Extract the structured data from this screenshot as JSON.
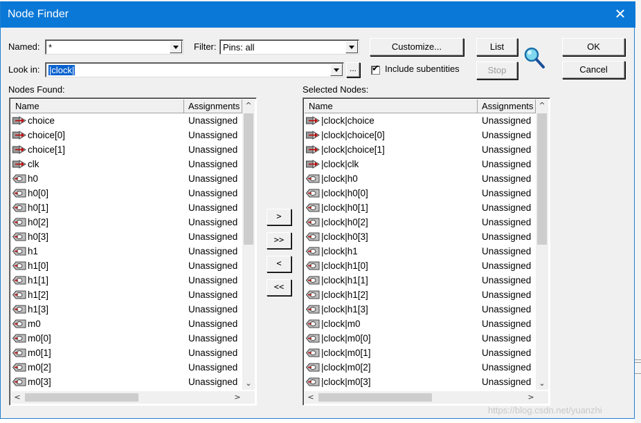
{
  "dialog": {
    "title": "Node Finder",
    "close_glyph": "✕"
  },
  "named": {
    "label": "Named:",
    "value": "*"
  },
  "filter": {
    "label": "Filter:",
    "value": "Pins: all"
  },
  "look_in": {
    "label": "Look in:",
    "value": "|clock|"
  },
  "browse_label": "...",
  "include_subentities": {
    "label": "Include subentities",
    "checked": true,
    "mark": "✔"
  },
  "buttons": {
    "customize": "Customize...",
    "list": "List",
    "stop": "Stop",
    "ok": "OK",
    "cancel": "Cancel",
    "move_one_right": ">",
    "move_all_right": ">>",
    "move_one_left": "<",
    "move_all_left": "<<"
  },
  "nodes_found": {
    "label": "Nodes Found:",
    "columns": [
      "Name",
      "Assignments"
    ],
    "rows": [
      {
        "name": "choice",
        "assign": "Unassigned",
        "icon": "input-pin-icon"
      },
      {
        "name": "choice[0]",
        "assign": "Unassigned",
        "icon": "input-pin-icon"
      },
      {
        "name": "choice[1]",
        "assign": "Unassigned",
        "icon": "input-pin-icon"
      },
      {
        "name": "clk",
        "assign": "Unassigned",
        "icon": "input-pin-icon"
      },
      {
        "name": "h0",
        "assign": "Unassigned",
        "icon": "output-pin-icon"
      },
      {
        "name": "h0[0]",
        "assign": "Unassigned",
        "icon": "output-pin-icon"
      },
      {
        "name": "h0[1]",
        "assign": "Unassigned",
        "icon": "output-pin-icon"
      },
      {
        "name": "h0[2]",
        "assign": "Unassigned",
        "icon": "output-pin-icon"
      },
      {
        "name": "h0[3]",
        "assign": "Unassigned",
        "icon": "output-pin-icon"
      },
      {
        "name": "h1",
        "assign": "Unassigned",
        "icon": "output-pin-icon"
      },
      {
        "name": "h1[0]",
        "assign": "Unassigned",
        "icon": "output-pin-icon"
      },
      {
        "name": "h1[1]",
        "assign": "Unassigned",
        "icon": "output-pin-icon"
      },
      {
        "name": "h1[2]",
        "assign": "Unassigned",
        "icon": "output-pin-icon"
      },
      {
        "name": "h1[3]",
        "assign": "Unassigned",
        "icon": "output-pin-icon"
      },
      {
        "name": "m0",
        "assign": "Unassigned",
        "icon": "output-pin-icon"
      },
      {
        "name": "m0[0]",
        "assign": "Unassigned",
        "icon": "output-pin-icon"
      },
      {
        "name": "m0[1]",
        "assign": "Unassigned",
        "icon": "output-pin-icon"
      },
      {
        "name": "m0[2]",
        "assign": "Unassigned",
        "icon": "output-pin-icon"
      },
      {
        "name": "m0[3]",
        "assign": "Unassigned",
        "icon": "output-pin-icon"
      }
    ]
  },
  "selected_nodes": {
    "label": "Selected Nodes:",
    "columns": [
      "Name",
      "Assignments"
    ],
    "rows": [
      {
        "name": "|clock|choice",
        "assign": "Unassigned",
        "icon": "input-pin-icon"
      },
      {
        "name": "|clock|choice[0]",
        "assign": "Unassigned",
        "icon": "input-pin-icon"
      },
      {
        "name": "|clock|choice[1]",
        "assign": "Unassigned",
        "icon": "input-pin-icon"
      },
      {
        "name": "|clock|clk",
        "assign": "Unassigned",
        "icon": "input-pin-icon"
      },
      {
        "name": "|clock|h0",
        "assign": "Unassigned",
        "icon": "output-pin-icon"
      },
      {
        "name": "|clock|h0[0]",
        "assign": "Unassigned",
        "icon": "output-pin-icon"
      },
      {
        "name": "|clock|h0[1]",
        "assign": "Unassigned",
        "icon": "output-pin-icon"
      },
      {
        "name": "|clock|h0[2]",
        "assign": "Unassigned",
        "icon": "output-pin-icon"
      },
      {
        "name": "|clock|h0[3]",
        "assign": "Unassigned",
        "icon": "output-pin-icon"
      },
      {
        "name": "|clock|h1",
        "assign": "Unassigned",
        "icon": "output-pin-icon"
      },
      {
        "name": "|clock|h1[0]",
        "assign": "Unassigned",
        "icon": "output-pin-icon"
      },
      {
        "name": "|clock|h1[1]",
        "assign": "Unassigned",
        "icon": "output-pin-icon"
      },
      {
        "name": "|clock|h1[2]",
        "assign": "Unassigned",
        "icon": "output-pin-icon"
      },
      {
        "name": "|clock|h1[3]",
        "assign": "Unassigned",
        "icon": "output-pin-icon"
      },
      {
        "name": "|clock|m0",
        "assign": "Unassigned",
        "icon": "output-pin-icon"
      },
      {
        "name": "|clock|m0[0]",
        "assign": "Unassigned",
        "icon": "output-pin-icon"
      },
      {
        "name": "|clock|m0[1]",
        "assign": "Unassigned",
        "icon": "output-pin-icon"
      },
      {
        "name": "|clock|m0[2]",
        "assign": "Unassigned",
        "icon": "output-pin-icon"
      },
      {
        "name": "|clock|m0[3]",
        "assign": "Unassigned",
        "icon": "output-pin-icon"
      }
    ]
  },
  "scroll_glyphs": {
    "up": "^",
    "down": "⌄",
    "left": "<",
    "right": ">"
  },
  "watermark": "https://blog.csdn.net/yuanzhi",
  "colors": {
    "titlebar": "#0a78d7",
    "selection": "#0a62cf"
  }
}
